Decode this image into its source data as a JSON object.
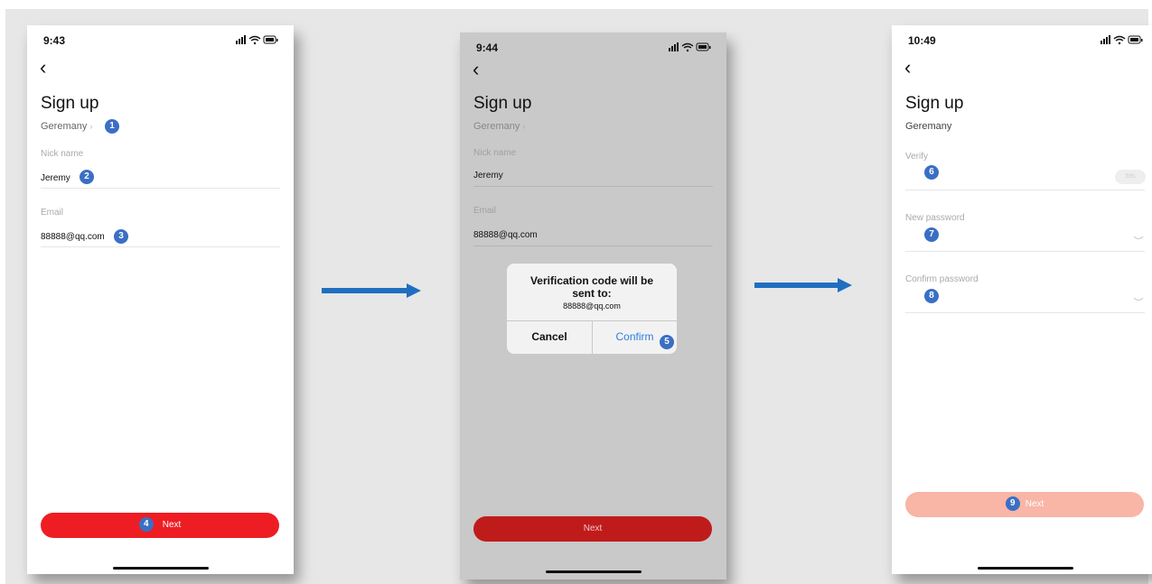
{
  "colors": {
    "accent_red": "#ee1d23",
    "dimmed_red": "#c01b1b",
    "disabled_red": "#f9b5a6",
    "badge_blue": "#3a6fc4",
    "arrow_blue": "#1f6fc0",
    "link_blue": "#2f7fe0"
  },
  "screen1": {
    "time": "9:43",
    "title": "Sign up",
    "country": "Geremany",
    "nick_label": "Nick name",
    "nick_value": "Jeremy",
    "email_label": "Email",
    "email_value": "88888@qq.com",
    "next_label": "Next",
    "badges": [
      "1",
      "2",
      "3",
      "4"
    ]
  },
  "screen2": {
    "time": "9:44",
    "title": "Sign up",
    "country": "Geremany",
    "nick_label": "Nick name",
    "nick_value": "Jeremy",
    "email_label": "Email",
    "email_value": "88888@qq.com",
    "dialog_title_1": "Verification code will be",
    "dialog_title_2": "sent to:",
    "dialog_message": "88888@qq.com",
    "cancel_label": "Cancel",
    "confirm_label": "Confirm",
    "next_label": "Next",
    "badge": "5"
  },
  "screen3": {
    "time": "10:49",
    "title": "Sign up",
    "country": "Geremany",
    "verify_label": "Verify",
    "verify_action": "59s",
    "new_password_label": "New password",
    "confirm_password_label": "Confirm password",
    "next_label": "Next",
    "badges": [
      "6",
      "7",
      "8",
      "9"
    ]
  }
}
